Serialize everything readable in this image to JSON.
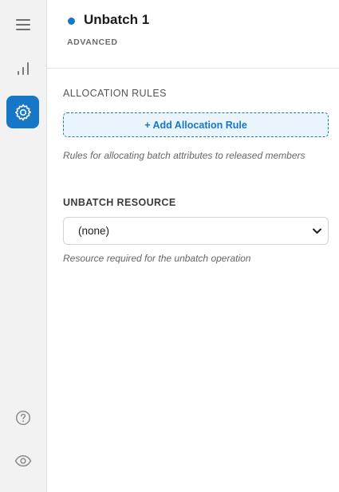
{
  "rail": {
    "items": [
      {
        "name": "menu-icon"
      },
      {
        "name": "chart-bars-icon"
      },
      {
        "name": "settings-gear-icon",
        "active": true
      },
      {
        "name": "help-circle-icon"
      },
      {
        "name": "eye-icon"
      }
    ]
  },
  "header": {
    "status_color": "#1677c9",
    "title": "Unbatch 1",
    "subtitle": "ADVANCED"
  },
  "allocation": {
    "heading": "ALLOCATION RULES",
    "add_button": "+ Add Allocation Rule",
    "help": "Rules for allocating batch attributes to released members"
  },
  "unbatch_resource": {
    "heading": "UNBATCH RESOURCE",
    "selected": "(none)",
    "help": "Resource required for the unbatch operation"
  },
  "colors": {
    "accent": "#1677c9",
    "rail_bg": "#f2f2f2"
  }
}
